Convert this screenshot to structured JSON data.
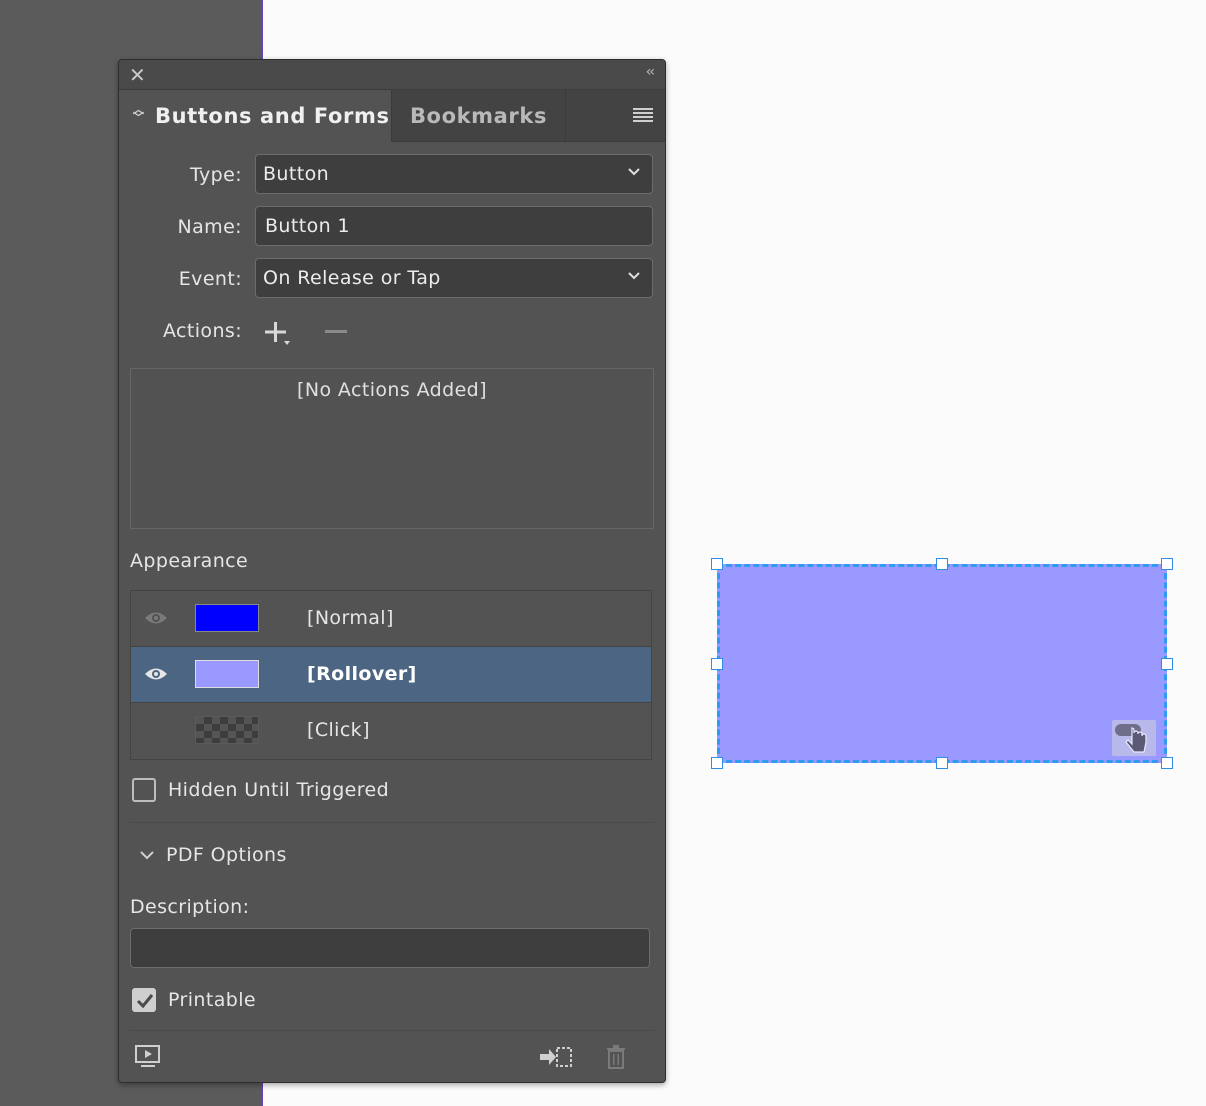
{
  "panel": {
    "tabs": [
      {
        "label": "Buttons and Forms"
      },
      {
        "label": "Bookmarks"
      }
    ],
    "type": {
      "label": "Type:",
      "value": "Button"
    },
    "name": {
      "label": "Name:",
      "value": "Button 1"
    },
    "event": {
      "label": "Event:",
      "value": "On Release or Tap"
    },
    "actions": {
      "label": "Actions:",
      "empty_text": "[No Actions Added]"
    },
    "appearance": {
      "label": "Appearance",
      "states": [
        {
          "label": "[Normal]",
          "color": "#0000ff",
          "selected": false
        },
        {
          "label": "[Rollover]",
          "color": "#9a99ff",
          "selected": true
        },
        {
          "label": "[Click]",
          "color": "checker",
          "selected": false
        }
      ]
    },
    "hidden_until_triggered": {
      "label": "Hidden Until Triggered",
      "checked": false
    },
    "pdf_options": {
      "label": "PDF Options",
      "description_label": "Description:",
      "description_value": "",
      "printable": {
        "label": "Printable",
        "checked": true
      }
    },
    "icons": [
      "close-icon",
      "collapse-icon",
      "panel-menu-icon",
      "add-action-icon",
      "remove-action-icon",
      "eye-icon",
      "preview-icon",
      "convert-object-icon",
      "trash-icon"
    ]
  },
  "canvas": {
    "button_fill": "#9a99ff",
    "selection_color": "#2f9bf0",
    "page_edge_color": "#6a3fbf"
  }
}
